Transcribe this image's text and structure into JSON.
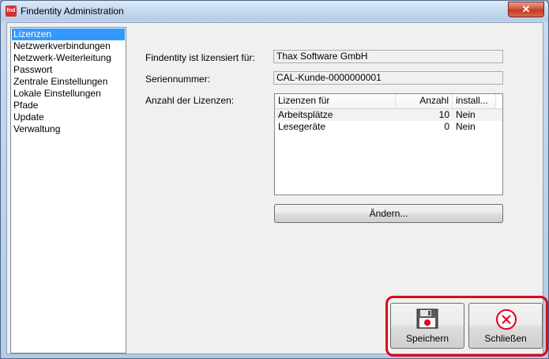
{
  "window": {
    "title": "Findentity Administration",
    "icon_text": "fnd",
    "close_glyph": "✕"
  },
  "nav": {
    "items": [
      {
        "label": "Lizenzen",
        "selected": true
      },
      {
        "label": "Netzwerkverbindungen"
      },
      {
        "label": "Netzwerk-Weiterleitung"
      },
      {
        "label": "Passwort"
      },
      {
        "label": "Zentrale Einstellungen"
      },
      {
        "label": "Lokale Einstellungen"
      },
      {
        "label": "Pfade"
      },
      {
        "label": "Update"
      },
      {
        "label": "Verwaltung"
      }
    ]
  },
  "license": {
    "licensed_to_label": "Findentity ist lizensiert für:",
    "licensed_to_value": "Thax Software GmbH",
    "serial_label": "Seriennummer:",
    "serial_value": "CAL-Kunde-0000000001",
    "count_label": "Anzahl der Lizenzen:",
    "table": {
      "columns": [
        "Lizenzen für",
        "Anzahl",
        "install..."
      ],
      "rows": [
        [
          "Arbeitsplätze",
          "10",
          "Nein"
        ],
        [
          "Lesegeräte",
          "0",
          "Nein"
        ]
      ]
    },
    "change_button": "Ändern..."
  },
  "footer": {
    "save_label": "Speichern",
    "close_label": "Schließen"
  },
  "colors": {
    "selection": "#3399ff",
    "highlight": "#e3001b",
    "close_button": "#c23a22"
  }
}
